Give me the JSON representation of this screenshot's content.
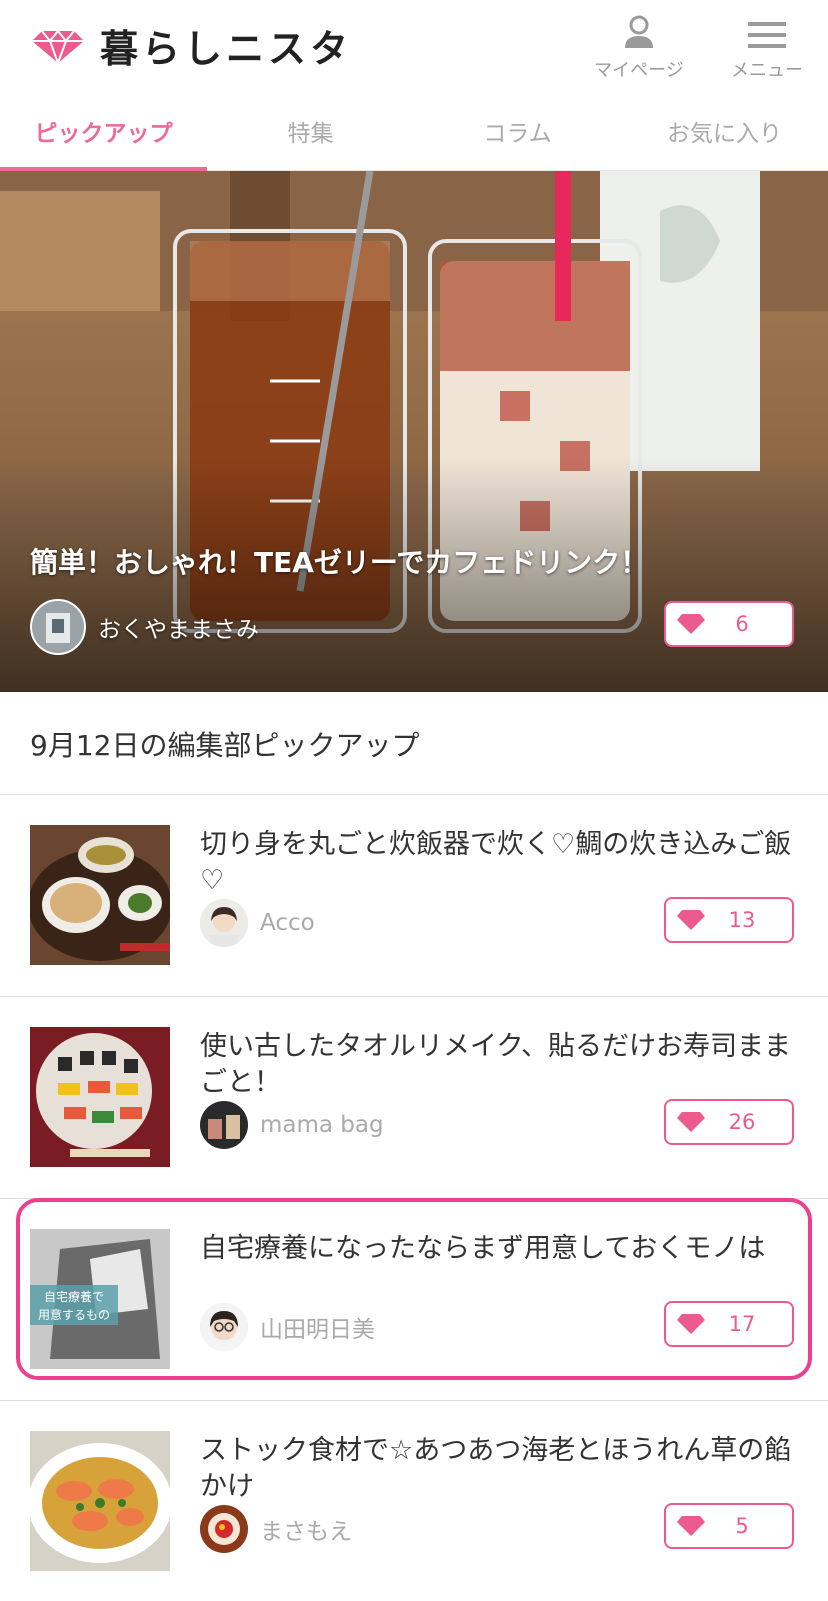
{
  "brand": {
    "name": "暮らしニスタ",
    "accent": "#ec6a9a"
  },
  "header": {
    "mypage_label": "マイページ",
    "menu_label": "メニュー"
  },
  "tabs": [
    {
      "label": "ピックアップ",
      "active": true
    },
    {
      "label": "特集",
      "active": false
    },
    {
      "label": "コラム",
      "active": false
    },
    {
      "label": "お気に入り",
      "active": false
    }
  ],
  "hero": {
    "title": "簡単！おしゃれ！TEAゼリーでカフェドリンク！",
    "author": "おくやままさみ",
    "likes": "6"
  },
  "section": {
    "title": "9月12日の編集部ピックアップ"
  },
  "items": [
    {
      "title": "切り身を丸ごと炊飯器で炊く♡鯛の炊き込みご飯♡",
      "author": "Acco",
      "likes": "13"
    },
    {
      "title": "使い古したタオルリメイク、貼るだけお寿司ままごと！",
      "author": "mama bag",
      "likes": "26"
    },
    {
      "title": "自宅療養になったならまず用意しておくモノは",
      "author": "山田明日美",
      "likes": "17",
      "thumb_text": [
        "自宅療養で",
        "用意するもの"
      ]
    },
    {
      "title": "ストック食材で☆あつあつ海老とほうれん草の餡かけ",
      "author": "まさもえ",
      "likes": "5"
    }
  ]
}
